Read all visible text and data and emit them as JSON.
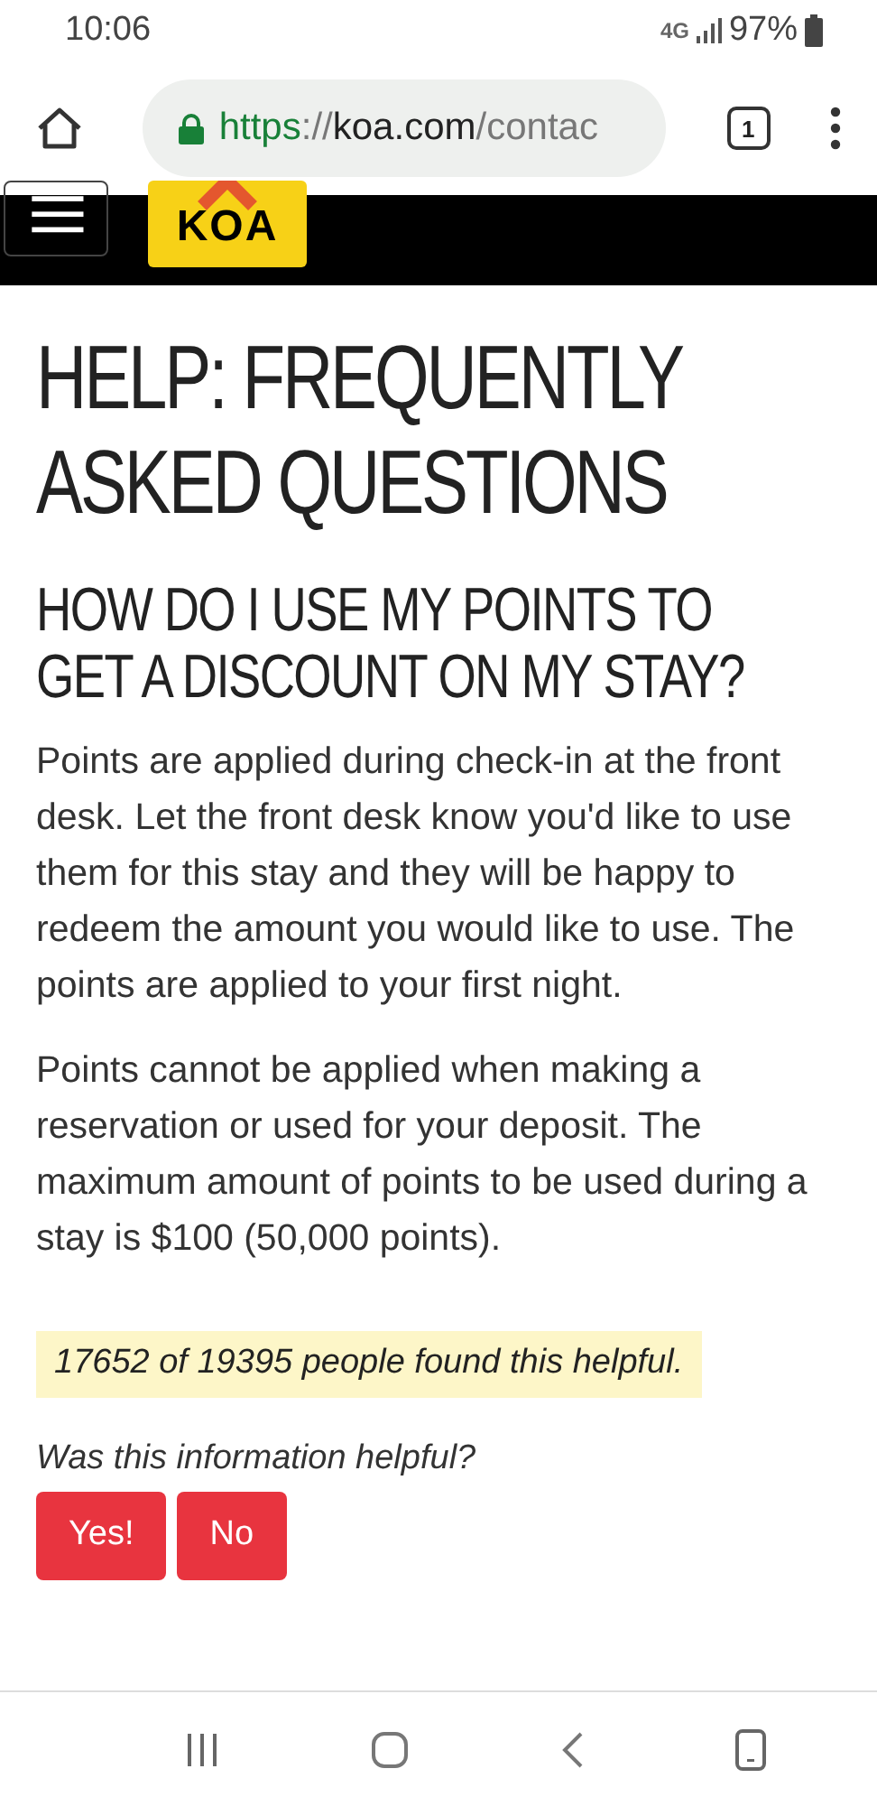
{
  "status_bar": {
    "time": "10:06",
    "network": "4G",
    "battery": "97%"
  },
  "browser": {
    "url": {
      "scheme": "https",
      "separator": "://",
      "host": "koa.com",
      "path": "/contac"
    },
    "secure": true,
    "tab_count": "1"
  },
  "site_header": {
    "logo_text": "KOA"
  },
  "page_title": "HELP: FREQUENTLY ASKED QUESTIONS",
  "question": "HOW DO I USE MY POINTS TO GET A DISCOUNT ON MY STAY?",
  "paragraphs": [
    "Points are applied during check-in at the front desk. Let the front desk know you'd like to use them for this stay and they will be happy to redeem the amount you would like to use. The points are applied to your first night.",
    "Points cannot be applied when making a reservation or used for your deposit. The maximum amount of points to be used during a stay is $100 (50,000 points)."
  ],
  "helpful_count": "17652 of 19395 people found this helpful.",
  "feedback_prompt": "Was this information helpful?",
  "feedback_buttons": [
    "Yes!",
    "No"
  ]
}
